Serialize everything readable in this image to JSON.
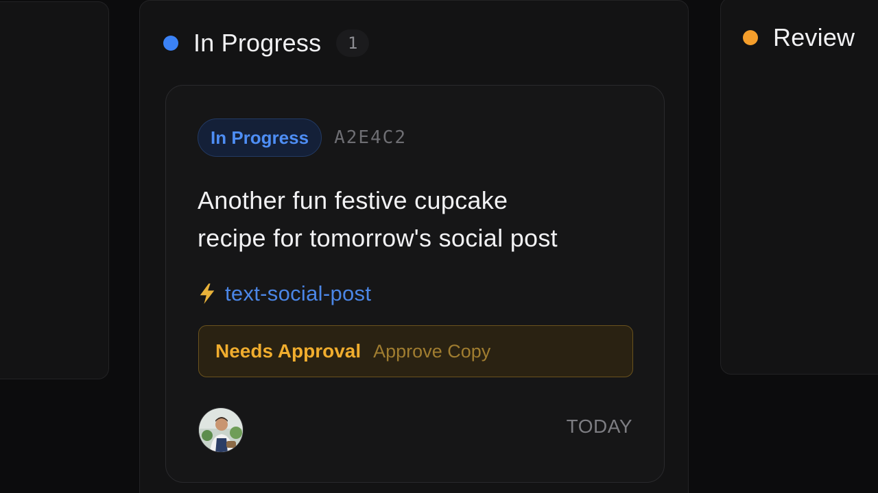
{
  "columns": {
    "in_progress": {
      "title": "In Progress",
      "count": "1",
      "dot_color": "#3b82f6"
    },
    "review": {
      "title": "Review",
      "dot_color": "#f59e2b"
    }
  },
  "card": {
    "status": "In Progress",
    "id": "A2E4C2",
    "title_line1": "Another fun festive cupcake",
    "title_line2": "recipe for tomorrow's social post",
    "workflow_icon": "lightning-bolt-icon",
    "workflow": "text-social-post",
    "approval": {
      "badge": "Needs Approval",
      "action": "Approve Copy"
    },
    "avatar_icon": "user-avatar",
    "date": "TODAY"
  },
  "colors": {
    "background": "#0c0c0d",
    "accent_blue": "#4e8ef5",
    "accent_amber": "#f0ad2e"
  }
}
